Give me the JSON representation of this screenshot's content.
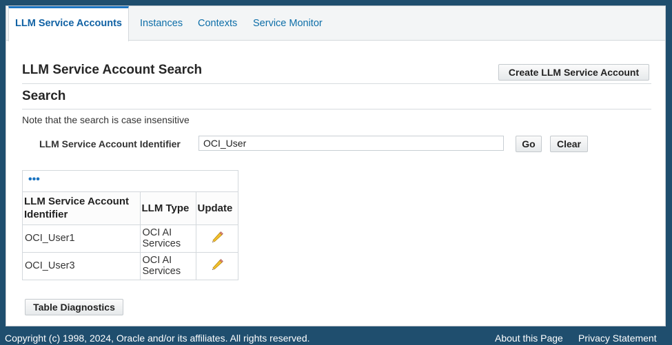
{
  "tabs": [
    {
      "label": "LLM Service Accounts",
      "active": true
    },
    {
      "label": "Instances",
      "active": false
    },
    {
      "label": "Contexts",
      "active": false
    },
    {
      "label": "Service Monitor",
      "active": false
    }
  ],
  "page_title": "LLM Service Account Search",
  "create_button_label": "Create LLM Service Account",
  "search": {
    "heading": "Search",
    "note": "Note that the search is case insensitive",
    "field_label": "LLM Service Account Identifier",
    "field_value": "OCI_User",
    "go_label": "Go",
    "clear_label": "Clear"
  },
  "table": {
    "toolbar_icon": "more-options-icon",
    "headers": [
      "LLM Service Account Identifier",
      "LLM Type",
      "Update"
    ],
    "rows": [
      {
        "identifier": "OCI_User1",
        "llm_type": "OCI AI Services",
        "update_icon": "pencil-icon"
      },
      {
        "identifier": "OCI_User3",
        "llm_type": "OCI AI Services",
        "update_icon": "pencil-icon"
      }
    ]
  },
  "table_diagnostics_label": "Table Diagnostics",
  "footer": {
    "copyright": "Copyright (c) 1998, 2024, Oracle and/or its affiliates. All rights reserved.",
    "about_link": "About this Page",
    "privacy_link": "Privacy Statement"
  },
  "colors": {
    "frame": "#1f4e6e",
    "link": "#0d6ea8",
    "active_tab_accent": "#1a73c0"
  }
}
